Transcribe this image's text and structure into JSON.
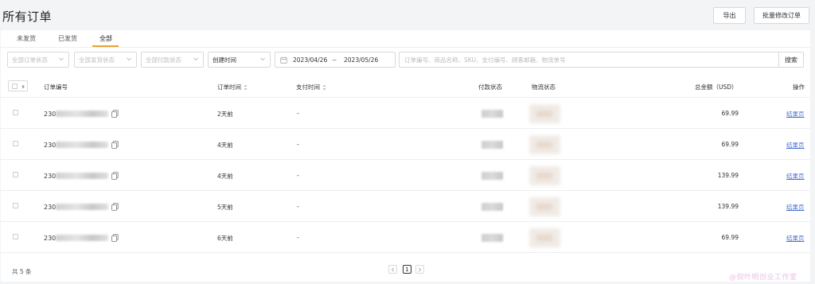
{
  "page": {
    "title": "所有订单",
    "export_label": "导出",
    "batch_edit_label": "批量修改订单"
  },
  "tabs": [
    {
      "label": "未发货"
    },
    {
      "label": "已发货"
    },
    {
      "label": "全部",
      "active": true
    }
  ],
  "filters": {
    "order_status": "全部订单状态",
    "ship_status": "全部发货状态",
    "pay_status": "全部付款状态",
    "time_type": "创建时间",
    "date_start": "2023/04/26",
    "date_sep": "~",
    "date_end": "2023/05/26",
    "search_placeholder": "订单编号、商品名称、SKU、支付编号、顾客邮箱、物流单号",
    "search_value": "",
    "search_label": "搜索"
  },
  "table": {
    "columns": {
      "order_no": "订单编号",
      "order_time": "订单时间",
      "pay_time": "支付时间",
      "pay_status": "付款状态",
      "ship_status": "物流状态",
      "total": "总金额（USD）",
      "action": "操作"
    },
    "rows": [
      {
        "order_prefix": "230",
        "order_time": "2天前",
        "pay_time": "-",
        "amount": "69.99",
        "action": "结果页"
      },
      {
        "order_prefix": "230",
        "order_time": "4天前",
        "pay_time": "-",
        "amount": "69.99",
        "action": "结果页"
      },
      {
        "order_prefix": "230",
        "order_time": "4天前",
        "pay_time": "-",
        "amount": "139.99",
        "action": "结果页"
      },
      {
        "order_prefix": "230",
        "order_time": "5天前",
        "pay_time": "-",
        "amount": "139.99",
        "action": "结果页"
      },
      {
        "order_prefix": "230",
        "order_time": "6天前",
        "pay_time": "-",
        "amount": "69.99",
        "action": "结果页"
      }
    ]
  },
  "footer": {
    "total_text": "共 5 条",
    "current_page": "1"
  },
  "watermark": "@倪叶明创业工作室",
  "colors": {
    "accent": "#f0a030",
    "link": "#4a6fd0"
  }
}
